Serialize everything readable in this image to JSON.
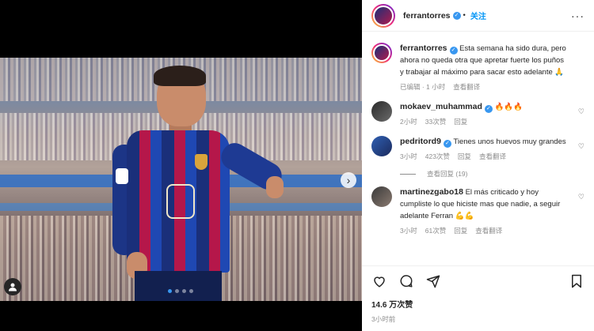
{
  "header": {
    "username": "ferrantorres",
    "follow_label": "关注",
    "more_label": "···"
  },
  "media": {
    "next_label": "›",
    "dots": 4,
    "active_dot": 0
  },
  "caption": {
    "username": "ferrantorres",
    "text": "Esta semana ha sido dura, pero ahora no queda otra que apretar fuerte los puños y trabajar al máximo para sacar esto adelante 🙏",
    "edited": "已编辑 · 1 小时",
    "translate": "查看翻译"
  },
  "comments": [
    {
      "username": "mokaev_muhammad",
      "verified": true,
      "text": "🔥🔥🔥",
      "time": "2小时",
      "likes": "33次赞",
      "reply": "回复",
      "translate": ""
    },
    {
      "username": "pedritord9",
      "verified": true,
      "text": "Tienes unos huevos muy grandes",
      "time": "3小时",
      "likes": "423次赞",
      "reply": "回复",
      "translate": "查看翻译",
      "view_replies": "查看回复 (19)"
    },
    {
      "username": "martinezgabo18",
      "verified": false,
      "text": "El más criticado y hoy cumpliste lo que hiciste mas que nadie, a seguir adelante Ferran 💪💪",
      "time": "3小时",
      "likes": "61次赞",
      "reply": "回复",
      "translate": "查看翻译"
    }
  ],
  "footer": {
    "likes": "14.6 万次赞",
    "time": "3小时前"
  },
  "colors": {
    "accent": "#0095f6",
    "verified": "#3897f0",
    "muted": "#8e8e8e",
    "text": "#262626"
  }
}
